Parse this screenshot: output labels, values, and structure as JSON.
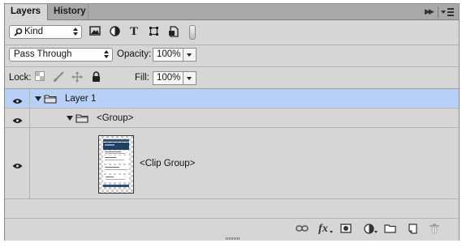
{
  "tabs": [
    {
      "label": "Layers",
      "active": true
    },
    {
      "label": "History",
      "active": false
    }
  ],
  "filter": {
    "kind_label": "Kind",
    "filter_icons": [
      "image-filter-icon",
      "adjustment-filter-icon",
      "type-filter-icon",
      "shape-filter-icon",
      "smart-object-filter-icon",
      "filter-toggle-icon"
    ]
  },
  "blend": {
    "mode": "Pass Through",
    "opacity_label": "Opacity:",
    "opacity_value": "100%"
  },
  "lock": {
    "label": "Lock:",
    "icons": [
      "lock-transparent-icon",
      "lock-image-icon",
      "lock-position-icon",
      "lock-all-icon"
    ],
    "fill_label": "Fill:",
    "fill_value": "100%"
  },
  "layers": [
    {
      "name": "Layer 1",
      "type": "group",
      "selected": true,
      "visible": true
    },
    {
      "name": "<Group>",
      "type": "group",
      "selected": false,
      "visible": true
    },
    {
      "name": "<Clip Group>",
      "type": "layer",
      "selected": false,
      "visible": true
    }
  ],
  "bottom_icons": [
    "link-icon",
    "fx-icon",
    "mask-icon",
    "adjustment-icon",
    "new-group-icon",
    "new-layer-icon",
    "trash-icon"
  ],
  "bottom_fx_label": "fx",
  "colors": {
    "selected_row": "#b8d0f5",
    "panel_bg": "#d6d6d6",
    "tabbar_bg": "#a9a9a9"
  }
}
